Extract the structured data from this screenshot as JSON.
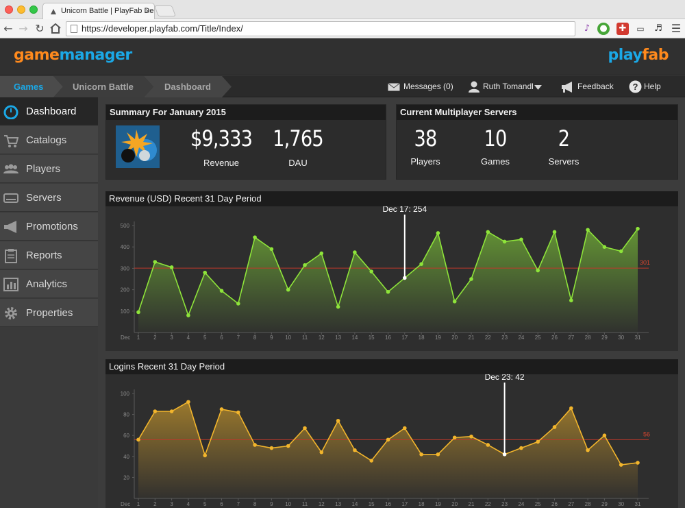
{
  "browser": {
    "tab_title": "Unicorn Battle | PlayFab De",
    "url": "https://developer.playfab.com/Title/Index/"
  },
  "header": {
    "logo_left_a": "game",
    "logo_left_b": "manager",
    "logo_right_a": "play",
    "logo_right_b": "fab"
  },
  "breadcrumb": [
    "Games",
    "Unicorn Battle",
    "Dashboard"
  ],
  "topnav": {
    "messages": "Messages (0)",
    "user": "Ruth Tomandl",
    "feedback": "Feedback",
    "help": "Help"
  },
  "sidebar": [
    {
      "label": "Dashboard",
      "icon": "dashboard-icon"
    },
    {
      "label": "Catalogs",
      "icon": "cart-icon"
    },
    {
      "label": "Players",
      "icon": "players-icon"
    },
    {
      "label": "Servers",
      "icon": "server-icon"
    },
    {
      "label": "Promotions",
      "icon": "megaphone-icon"
    },
    {
      "label": "Reports",
      "icon": "clipboard-icon"
    },
    {
      "label": "Analytics",
      "icon": "analytics-icon"
    },
    {
      "label": "Properties",
      "icon": "gear-icon"
    }
  ],
  "summary": {
    "title": "Summary For January 2015",
    "revenue_value": "$9,333",
    "revenue_label": "Revenue",
    "dau_value": "1,765",
    "dau_label": "DAU"
  },
  "servers": {
    "title": "Current Multiplayer Servers",
    "players_value": "38",
    "players_label": "Players",
    "games_value": "10",
    "games_label": "Games",
    "servers_value": "2",
    "servers_label": "Servers"
  },
  "colors": {
    "revenue_line": "#8ee43a",
    "logins_line": "#f2b52c",
    "average_line": "#c0392b",
    "accent_blue": "#1ba8e6",
    "accent_orange": "#ff8a1d"
  },
  "chart_data": [
    {
      "type": "area",
      "title": "Revenue (USD) Recent 31 Day Period",
      "x_first_label": "Dec",
      "x": [
        1,
        2,
        3,
        4,
        5,
        6,
        7,
        8,
        9,
        10,
        11,
        12,
        13,
        14,
        15,
        16,
        17,
        18,
        19,
        20,
        21,
        22,
        23,
        24,
        25,
        26,
        27,
        28,
        29,
        30,
        31
      ],
      "values": [
        95,
        330,
        305,
        80,
        280,
        195,
        135,
        445,
        390,
        200,
        315,
        370,
        120,
        375,
        285,
        190,
        255,
        320,
        465,
        145,
        250,
        470,
        425,
        435,
        290,
        470,
        150,
        480,
        400,
        380,
        485
      ],
      "ylim": [
        0,
        500
      ],
      "yticks": [
        100,
        200,
        300,
        400,
        500
      ],
      "average": 301,
      "average_label": "301",
      "marker_index": 16,
      "marker_label": "Dec 17:  254"
    },
    {
      "type": "area",
      "title": "Logins Recent 31 Day Period",
      "x_first_label": "Dec",
      "x": [
        1,
        2,
        3,
        4,
        5,
        6,
        7,
        8,
        9,
        10,
        11,
        12,
        13,
        14,
        15,
        16,
        17,
        18,
        19,
        20,
        21,
        22,
        23,
        24,
        25,
        26,
        27,
        28,
        29,
        30,
        31
      ],
      "values": [
        56,
        83,
        83,
        92,
        41,
        85,
        82,
        51,
        48,
        50,
        67,
        44,
        74,
        46,
        36,
        56,
        67,
        42,
        42,
        58,
        59,
        51,
        42,
        48,
        54,
        68,
        86,
        46,
        60,
        32,
        34
      ],
      "ylim": [
        0,
        100
      ],
      "yticks": [
        20,
        40,
        60,
        80,
        100
      ],
      "average": 56,
      "average_label": "56",
      "marker_index": 22,
      "marker_label": "Dec 23:  42"
    }
  ]
}
